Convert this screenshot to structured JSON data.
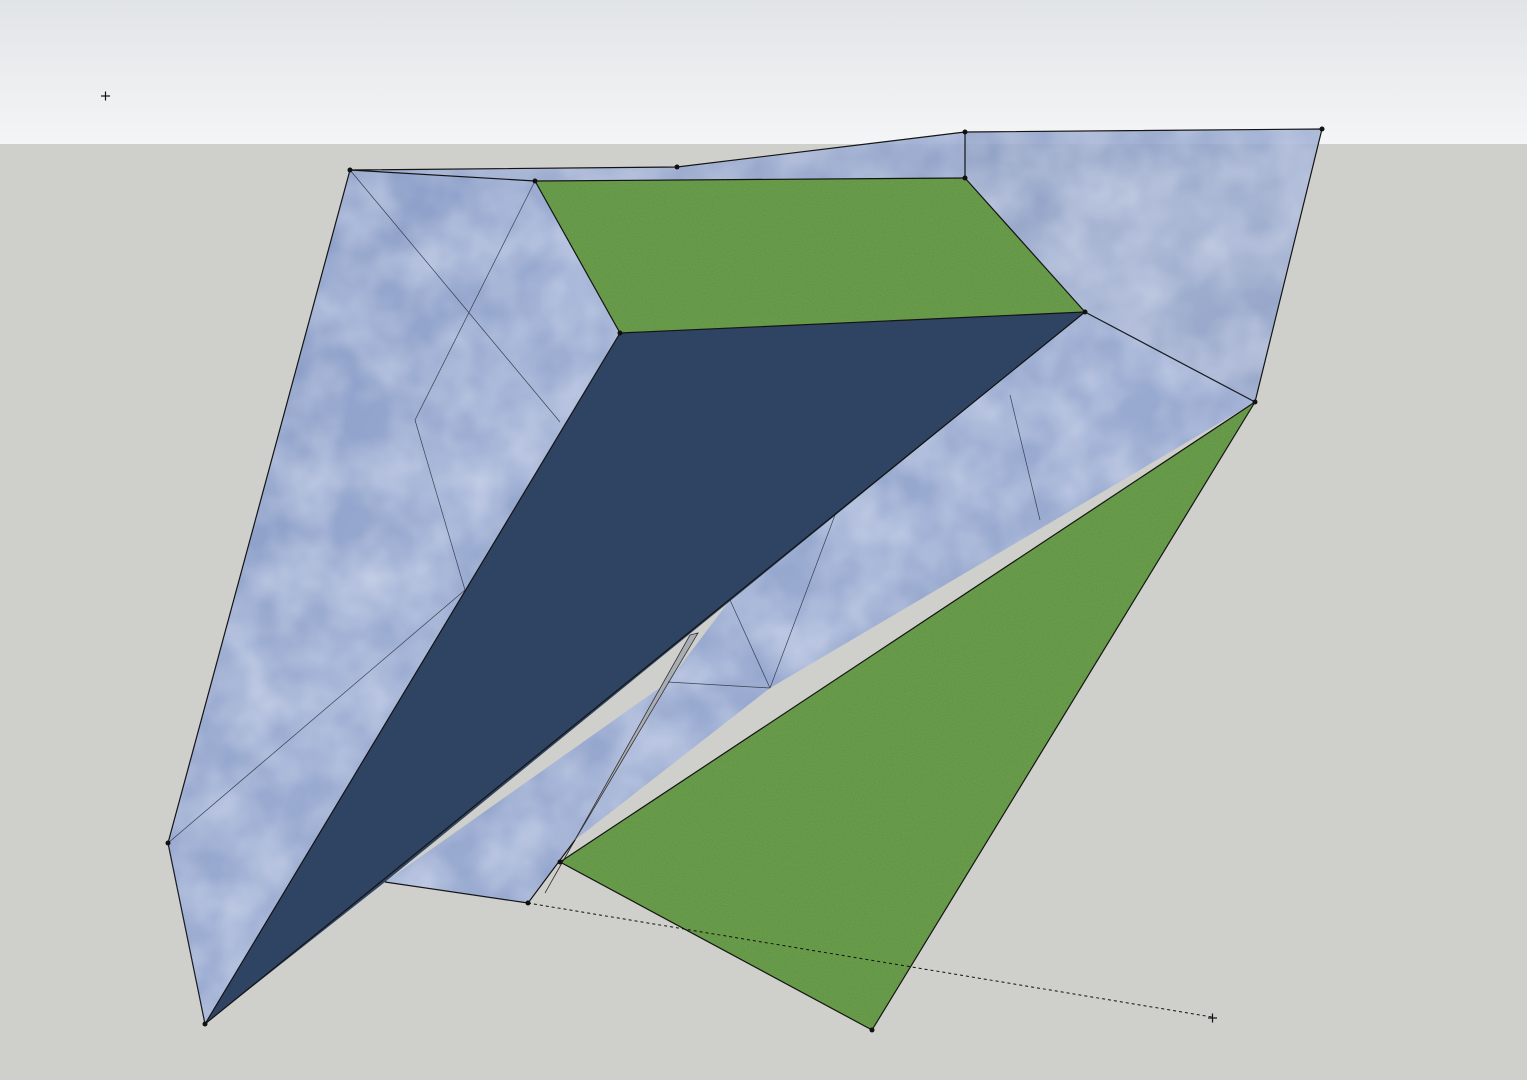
{
  "app": {
    "type": "3d-modeling-viewport"
  },
  "scene": {
    "sky_color_top": "#e2e5e8",
    "sky_color_bottom": "#f3f4f5",
    "ground_color": "#cfcfcb",
    "edge_color": "#111111",
    "materials": {
      "sky_texture": "#8d9fc6",
      "grass_texture": "#5c8f3a",
      "navy_face": "#2f4462"
    }
  }
}
